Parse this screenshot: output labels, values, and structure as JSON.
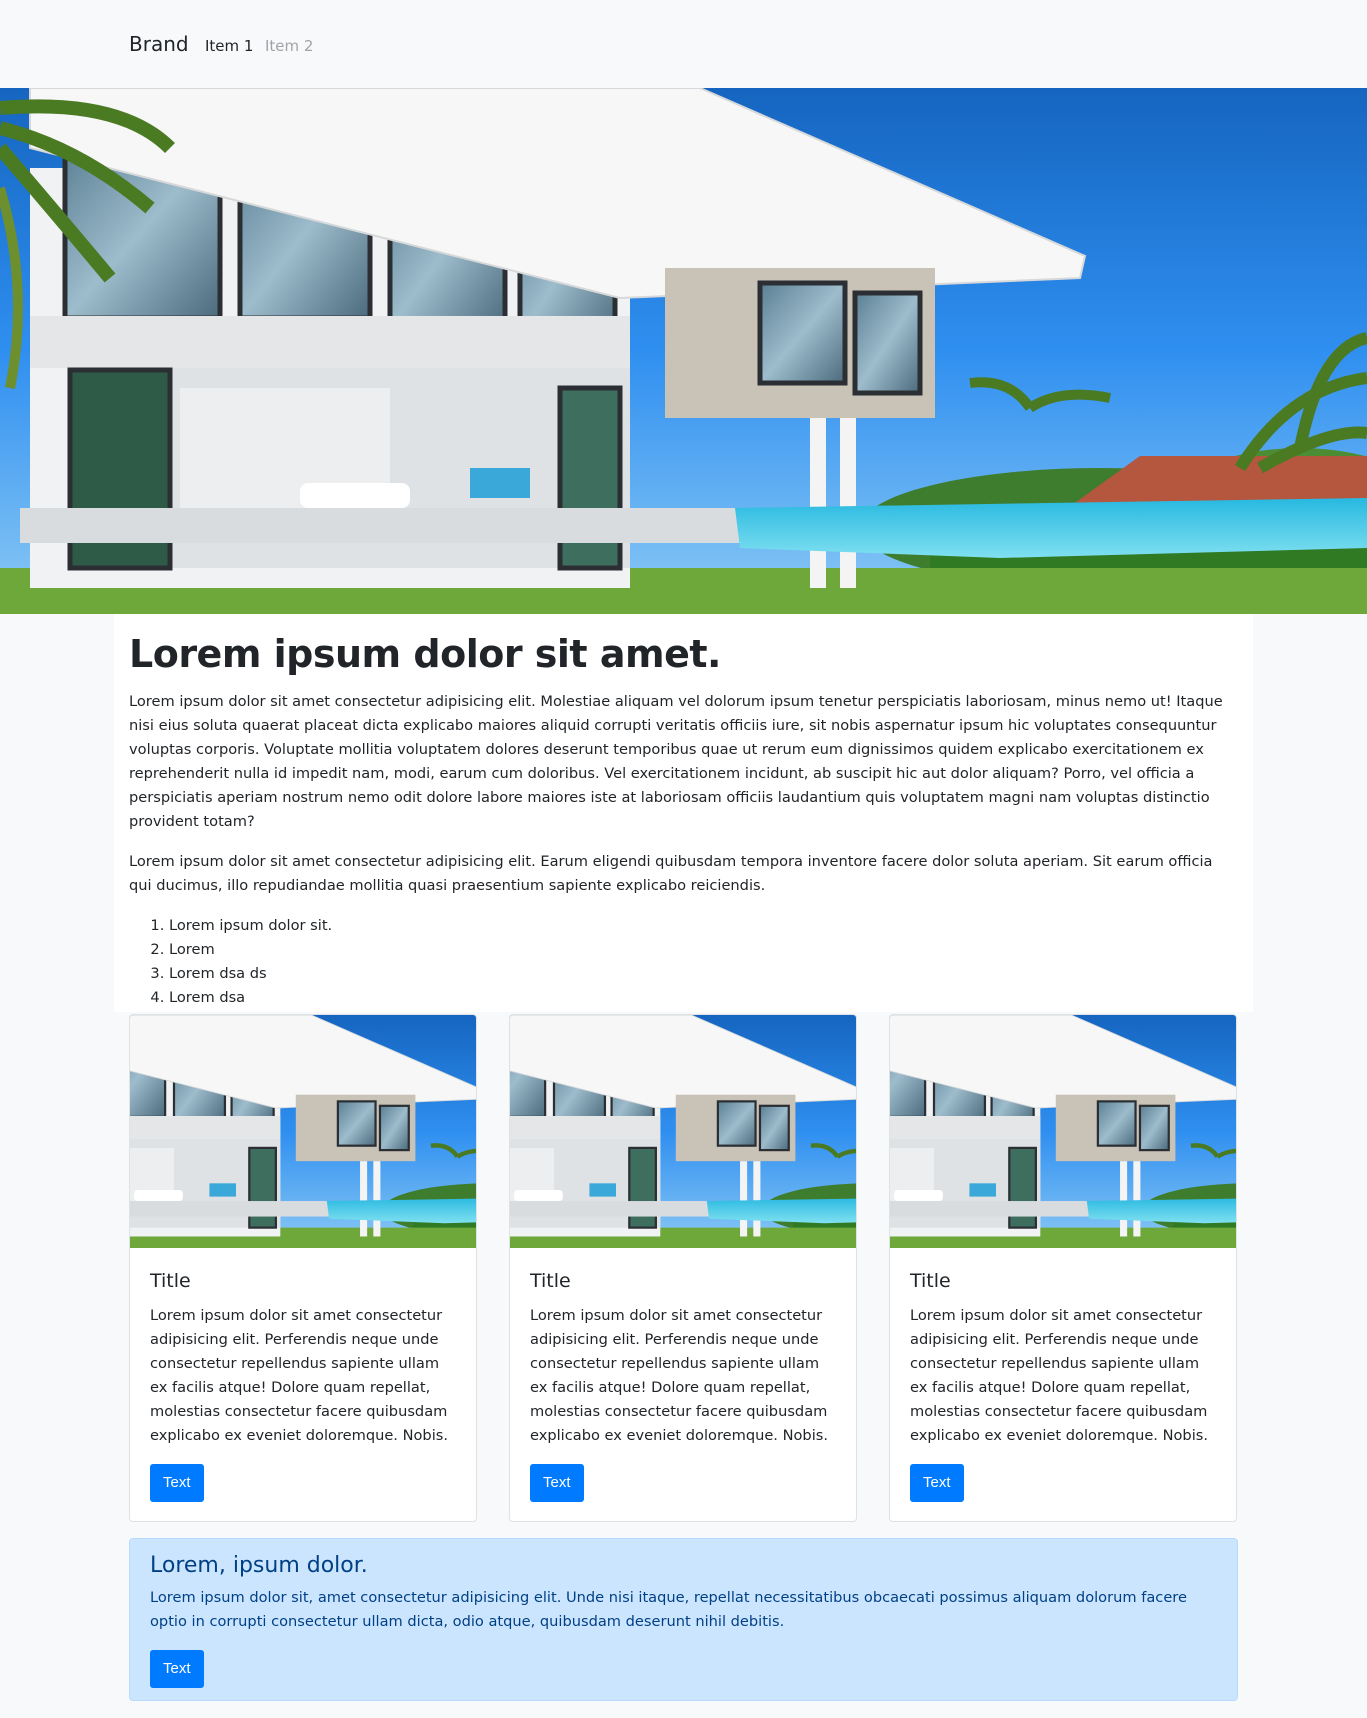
{
  "navbar": {
    "brand": "Brand",
    "items": [
      {
        "label": "Item 1",
        "state": "active"
      },
      {
        "label": "Item 2",
        "state": "disabled"
      }
    ]
  },
  "hero": {
    "image": "modern-villa-photo"
  },
  "intro": {
    "heading": "Lorem ipsum dolor sit amet.",
    "paragraph1": "Lorem ipsum dolor sit amet consectetur adipisicing elit. Molestiae aliquam vel dolorum ipsum tenetur perspiciatis laboriosam, minus nemo ut! Itaque nisi eius soluta quaerat placeat dicta explicabo maiores aliquid corrupti veritatis officiis iure, sit nobis aspernatur ipsum hic voluptates consequuntur voluptas corporis. Voluptate mollitia voluptatem dolores deserunt temporibus quae ut rerum eum dignissimos quidem explicabo exercitationem ex reprehenderit nulla id impedit nam, modi, earum cum doloribus. Vel exercitationem incidunt, ab suscipit hic aut dolor aliquam? Porro, vel officia a perspiciatis aperiam nostrum nemo odit dolore labore maiores iste at laboriosam officiis laudantium quis voluptatem magni nam voluptas distinctio provident totam?",
    "paragraph2": "Lorem ipsum dolor sit amet consectetur adipisicing elit. Earum eligendi quibusdam tempora inventore facere dolor soluta aperiam. Sit earum officia qui ducimus, illo repudiandae mollitia quasi praesentium sapiente explicabo reiciendis.",
    "list": [
      "Lorem ipsum dolor sit.",
      "Lorem",
      "Lorem dsa ds",
      "Lorem dsa"
    ]
  },
  "cards": [
    {
      "title": "Title",
      "text": "Lorem ipsum dolor sit amet consectetur adipisicing elit. Perferendis neque unde consectetur repellendus sapiente ullam ex facilis atque! Dolore quam repellat, molestias consectetur facere quibusdam explicabo ex eveniet doloremque. Nobis.",
      "button": "Text"
    },
    {
      "title": "Title",
      "text": "Lorem ipsum dolor sit amet consectetur adipisicing elit. Perferendis neque unde consectetur repellendus sapiente ullam ex facilis atque! Dolore quam repellat, molestias consectetur facere quibusdam explicabo ex eveniet doloremque. Nobis.",
      "button": "Text"
    },
    {
      "title": "Title",
      "text": "Lorem ipsum dolor sit amet consectetur adipisicing elit. Perferendis neque unde consectetur repellendus sapiente ullam ex facilis atque! Dolore quam repellat, molestias consectetur facere quibusdam explicabo ex eveniet doloremque. Nobis.",
      "button": "Text"
    }
  ],
  "alert": {
    "heading": "Lorem, ipsum dolor.",
    "text": "Lorem ipsum dolor sit, amet consectetur adipisicing elit. Unde nisi itaque, repellat necessitatibus obcaecati possimus aliquam dolorum facere optio in corrupti consectetur ullam dicta, odio atque, quibusdam deserunt nihil debitis.",
    "button": "Text"
  },
  "colors": {
    "primary": "#007bff",
    "alert_bg": "#cce5ff",
    "alert_text": "#004085",
    "page_bg": "#f8f9fa"
  }
}
